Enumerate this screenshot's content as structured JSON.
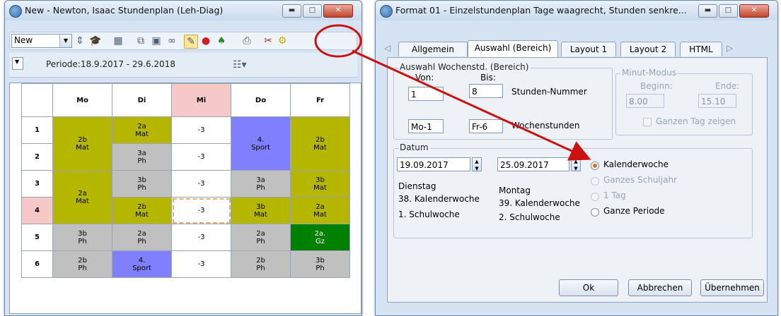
{
  "left_window": {
    "title": "New - Newton, Isaac  Stundenplan  (Leh-Diag)",
    "combo_value": "New",
    "period": "Periode:18.9.2017 - 29.6.2018",
    "timetable": {
      "days": [
        "Mo",
        "Di",
        "Mi",
        "Do",
        "Fr"
      ],
      "periods": [
        "1",
        "2",
        "3",
        "4",
        "5",
        "6"
      ],
      "mo": {
        "b1": {
          "cls": "2b",
          "subj": "Mat"
        },
        "b2": {
          "cls": "2a",
          "subj": "Mat"
        },
        "p5": {
          "cls": "3b",
          "subj": "Ph"
        },
        "p6": {
          "cls": "2b",
          "subj": "Ph"
        }
      },
      "di": {
        "p1": {
          "cls": "2a",
          "subj": "Mat"
        },
        "p2": {
          "cls": "3a",
          "subj": "Ph"
        },
        "p3": {
          "cls": "3b",
          "subj": "Ph"
        },
        "p4": {
          "cls": "2b",
          "subj": "Mat"
        },
        "p5": {
          "cls": "2a",
          "subj": "Ph"
        },
        "p6": {
          "cls": "4.",
          "subj": "Sport"
        }
      },
      "mi": [
        "-3",
        "-3",
        "-3",
        "-3",
        "-3",
        "-3"
      ],
      "do": {
        "b1": {
          "cls": "4.",
          "subj": "Sport"
        },
        "p3": {
          "cls": "3a",
          "subj": "Ph"
        },
        "p4": {
          "cls": "3b",
          "subj": "Mat"
        },
        "p5": {
          "cls": "2a",
          "subj": "Ph"
        },
        "p6": {
          "cls": "2b",
          "subj": "Ph"
        }
      },
      "fr": {
        "b1": {
          "cls": "2b",
          "subj": "Mat"
        },
        "p3": {
          "cls": "3b",
          "subj": "Mat"
        },
        "p4": {
          "cls": "2a",
          "subj": "Mat"
        },
        "p5": {
          "cls": "2a.",
          "subj": "Gz"
        },
        "p6": {
          "cls": "3b",
          "subj": "Ph"
        }
      }
    }
  },
  "right_window": {
    "title": "Format 01 - Einzelstundenplan Tage waagrecht, Stunden senkre...",
    "tabs": [
      "Allgemein",
      "Auswahl (Bereich)",
      "Layout 1",
      "Layout 2",
      "HTML"
    ],
    "group_range": "Auswahl Wochenstd. (Bereich)",
    "von_label": "Von:",
    "bis_label": "Bis:",
    "von_value": "1",
    "bis_value": "8",
    "stunden_nummer": "Stunden-Nummer",
    "von2_value": "Mo-1",
    "bis2_value": "Fr-6",
    "wochenstunden": "Wochenstunden",
    "minut_group": "Minut-Modus",
    "beginn_label": "Beginn:",
    "ende_label": "Ende:",
    "beginn_value": "8.00",
    "ende_value": "15.10",
    "ganzen_tag": "Ganzen Tag zeigen",
    "datum_group": "Datum",
    "date_from": "19.09.2017",
    "date_to": "25.09.2017",
    "from_day": "Dienstag",
    "from_kw": "38. Kalenderwoche",
    "from_sw": "1. Schulwoche",
    "to_day": "Montag",
    "to_kw": "39. Kalenderwoche",
    "to_sw": "2. Schulwoche",
    "radio_options": [
      "Kalenderwoche",
      "Ganzes Schuljahr",
      "1 Tag",
      "Ganze Periode"
    ],
    "selected_option": "Kalenderwoche",
    "ok_label": "Ok",
    "cancel_label": "Abbrechen",
    "apply_label": "Übernehmen"
  },
  "colors": {
    "olive": "#b5b600",
    "gray": "#c0c0c0",
    "blue": "#8080ff",
    "green": "#008000",
    "highlight": "#f6c8c8",
    "annotation": "#cc1111"
  },
  "icons": [
    "app-icon",
    "hat-icon",
    "grid-icon",
    "lock-icon",
    "pencil-icon",
    "red-pin-icon",
    "users-icon",
    "print-icon",
    "scissors-icon",
    "gear-icon",
    "calendar-icon"
  ]
}
